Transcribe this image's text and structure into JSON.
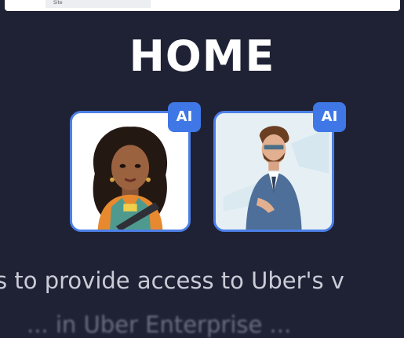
{
  "browser": {
    "tab_label": "Site"
  },
  "page": {
    "title": "HOME"
  },
  "avatars": [
    {
      "badge": "AI",
      "icon": "woman-avatar-icon"
    },
    {
      "badge": "AI",
      "icon": "man-avatar-icon"
    }
  ],
  "mission_text": "is to provide access to Uber's v",
  "mission_text_2": "... in Uber Enterprise ..."
}
